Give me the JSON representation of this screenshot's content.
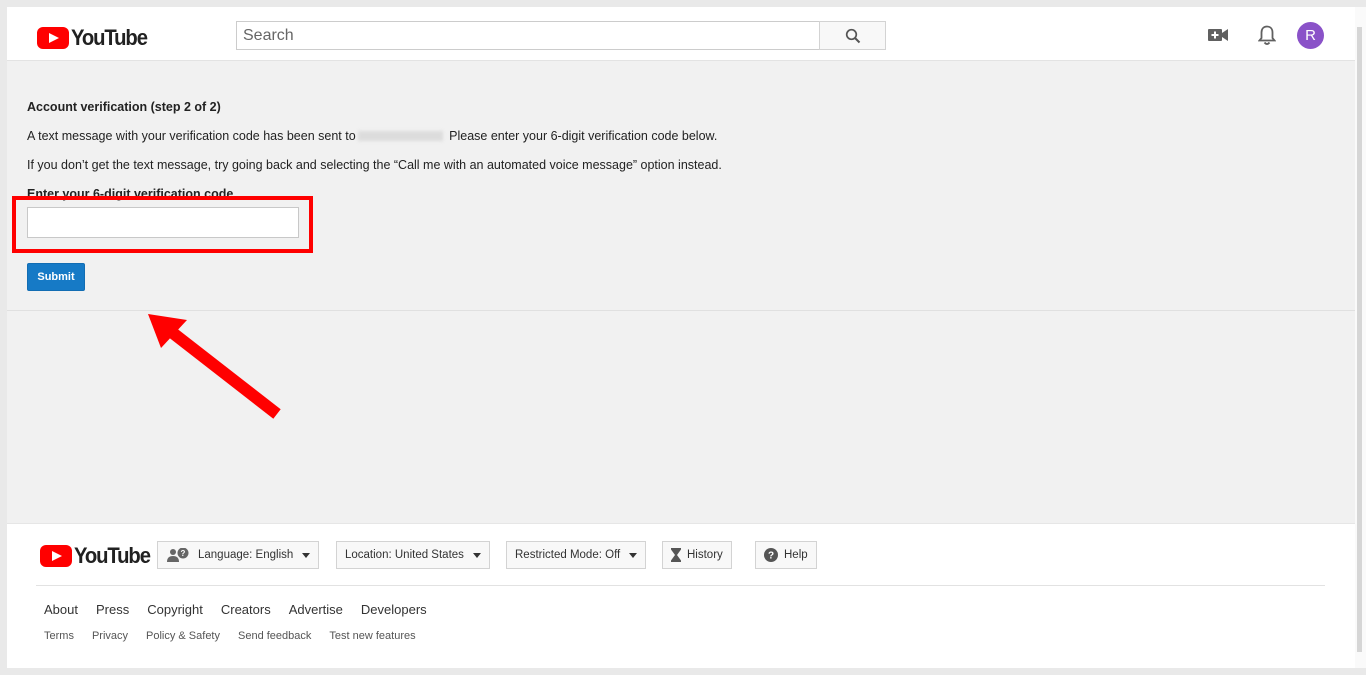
{
  "header": {
    "logo_text": "YouTube",
    "search_placeholder": "Search",
    "search_icon": "search-icon",
    "upload_icon": "video-camera-plus-icon",
    "notifications_icon": "bell-icon",
    "avatar_letter": "R",
    "avatar_color": "#8a52c8"
  },
  "main": {
    "heading": "Account verification (step 2 of 2)",
    "sent_text_before": "A text message with your verification code has been sent to",
    "sent_text_after": "Please enter your 6-digit verification code below.",
    "fallback_text": "If you don’t get the text message, try going back and selecting the “Call me with an automated voice message” option instead.",
    "code_label": "Enter your 6-digit verification code",
    "code_value": "",
    "submit_label": "Submit",
    "accent_color": "#167ac6",
    "highlight_color": "#ff0000"
  },
  "footer": {
    "logo_text": "YouTube",
    "language_label": "Language: English",
    "location_label": "Location: United States",
    "restricted_label": "Restricted Mode: Off",
    "history_label": "History",
    "help_label": "Help",
    "links_primary": [
      "About",
      "Press",
      "Copyright",
      "Creators",
      "Advertise",
      "Developers"
    ],
    "links_secondary": [
      "Terms",
      "Privacy",
      "Policy & Safety",
      "Send feedback",
      "Test new features"
    ]
  }
}
